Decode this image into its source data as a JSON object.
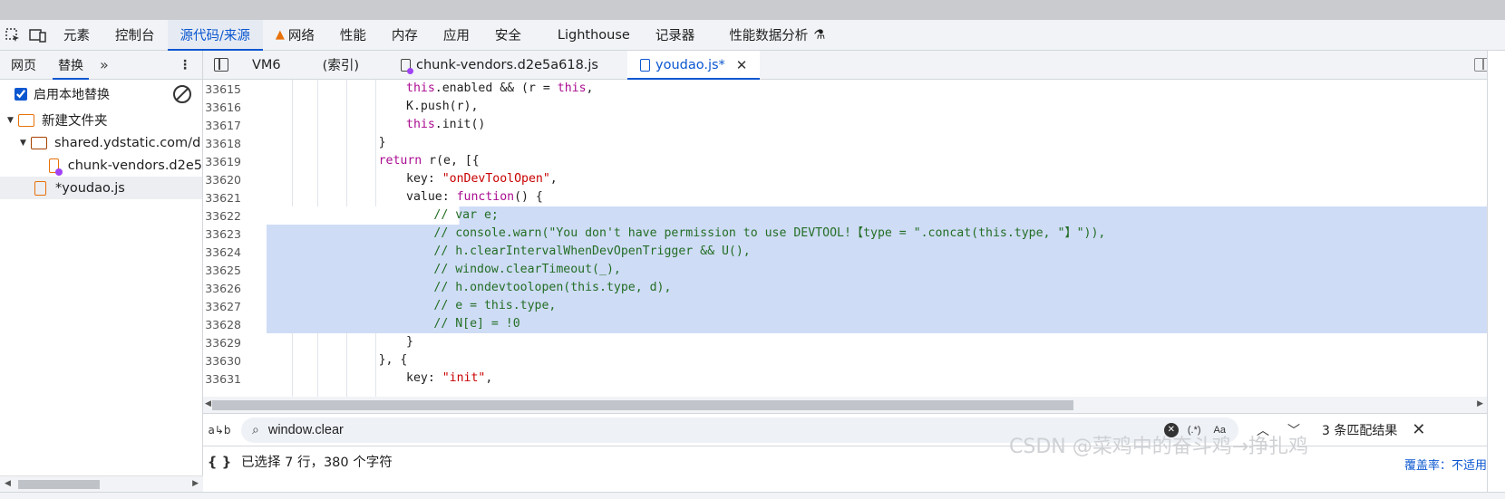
{
  "toolbar": {
    "tabs": [
      "元素",
      "控制台",
      "源代码/来源",
      "网络",
      "性能",
      "内存",
      "应用",
      "安全",
      "Lighthouse",
      "记录器",
      "性能数据分析"
    ]
  },
  "left": {
    "tabs": [
      "网页",
      "替换"
    ],
    "option_label": "启用本地替换",
    "tree": [
      "新建文件夹",
      "shared.ydstatic.com/d",
      "chunk-vendors.d2e5",
      "*youdao.js"
    ]
  },
  "editor": {
    "tabs": [
      "VM6",
      "(索引)",
      "chunk-vendors.d2e5a618.js",
      "youdao.js*"
    ],
    "lines": [
      {
        "n": "33615",
        "ind": 10,
        "t": "this.enabled && (r = this,",
        "k": "code"
      },
      {
        "n": "33616",
        "ind": 10,
        "t": "K.push(r),",
        "k": "code"
      },
      {
        "n": "33617",
        "ind": 10,
        "t": "this.init()",
        "k": "code"
      },
      {
        "n": "33618",
        "ind": 8,
        "t": "}",
        "k": "code"
      },
      {
        "n": "33619",
        "ind": 8,
        "t": "return r(e, [{",
        "k": "code"
      },
      {
        "n": "33620",
        "ind": 10,
        "t": "key: \"onDevToolOpen\",",
        "k": "code"
      },
      {
        "n": "33621",
        "ind": 10,
        "t": "value: function() {",
        "k": "code"
      },
      {
        "n": "33622",
        "ind": 12,
        "t": "// var e;",
        "k": "cmt"
      },
      {
        "n": "33623",
        "ind": 12,
        "t": "// console.warn(\"You don't have permission to use DEVTOOL!【type = \".concat(this.type, \"】\")),",
        "k": "cmt"
      },
      {
        "n": "33624",
        "ind": 12,
        "t": "// h.clearIntervalWhenDevOpenTrigger && U(),",
        "k": "cmt"
      },
      {
        "n": "33625",
        "ind": 12,
        "t": "// window.clearTimeout(_),",
        "k": "cmt"
      },
      {
        "n": "33626",
        "ind": 12,
        "t": "// h.ondevtoolopen(this.type, d),",
        "k": "cmt"
      },
      {
        "n": "33627",
        "ind": 12,
        "t": "// e = this.type,",
        "k": "cmt"
      },
      {
        "n": "33628",
        "ind": 12,
        "t": "// N[e] = !0",
        "k": "cmt"
      },
      {
        "n": "33629",
        "ind": 10,
        "t": "}",
        "k": "code"
      },
      {
        "n": "33630",
        "ind": 8,
        "t": "}, {",
        "k": "code"
      },
      {
        "n": "33631",
        "ind": 10,
        "t": "key: \"init\",",
        "k": "code"
      }
    ]
  },
  "search": {
    "value": "window.clear",
    "regex_label": "(.*)",
    "case_label": "Aa",
    "matches": "3 条匹配结果"
  },
  "status": {
    "selection": "已选择 7 行，380 个字符",
    "coverage": "覆盖率：不适用"
  },
  "watermark": "CSDN @菜鸡中的奋斗鸡→挣扎鸡"
}
